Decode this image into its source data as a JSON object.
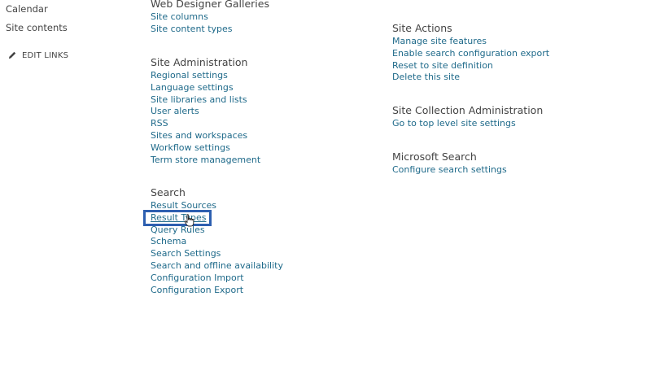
{
  "quick_launch": {
    "calendar": "Calendar",
    "site_contents": "Site contents",
    "edit_links": "EDIT LINKS"
  },
  "left_column": {
    "web_designer_galleries": {
      "title": "Web Designer Galleries",
      "links": [
        "Site columns",
        "Site content types"
      ]
    },
    "site_administration": {
      "title": "Site Administration",
      "links": [
        "Regional settings",
        "Language settings",
        "Site libraries and lists",
        "User alerts",
        "RSS",
        "Sites and workspaces",
        "Workflow settings",
        "Term store management"
      ]
    },
    "search": {
      "title": "Search",
      "links": [
        "Result Sources",
        "Result Types",
        "Query Rules",
        "Schema",
        "Search Settings",
        "Search and offline availability",
        "Configuration Import",
        "Configuration Export"
      ]
    }
  },
  "right_column": {
    "site_actions": {
      "title": "Site Actions",
      "links": [
        "Manage site features",
        "Enable search configuration export",
        "Reset to site definition",
        "Delete this site"
      ]
    },
    "site_collection_administration": {
      "title": "Site Collection Administration",
      "links": [
        "Go to top level site settings"
      ]
    },
    "microsoft_search": {
      "title": "Microsoft Search",
      "links": [
        "Configure search settings"
      ]
    }
  },
  "colors": {
    "link": "#1f6a8a",
    "heading": "#444444",
    "highlight": "#2d5fb0"
  },
  "icons": {
    "edit": "pencil-icon",
    "cursor": "hand-pointer-icon"
  }
}
